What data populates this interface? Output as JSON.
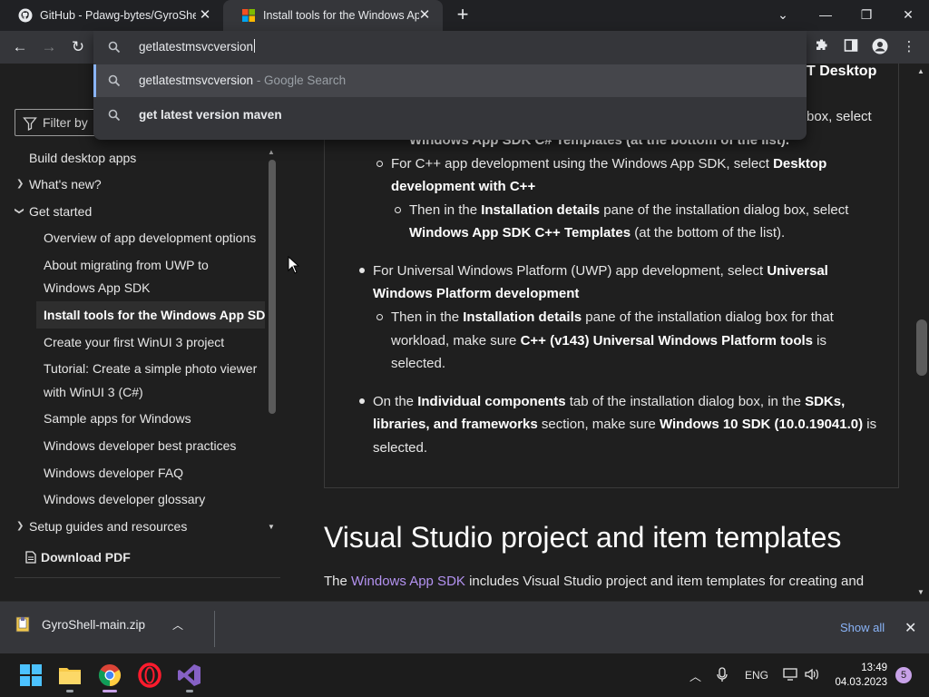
{
  "tabs": [
    {
      "title": "GitHub - Pdawg-bytes/GyroShell",
      "icon": "github-icon",
      "active": false
    },
    {
      "title": "Install tools for the Windows App",
      "icon": "microsoft-logo-icon",
      "active": true
    }
  ],
  "omnibox": {
    "value": "getlatestmsvcversion",
    "suggestions": [
      {
        "text": "getlatestmsvcversion",
        "suffix": " - Google Search",
        "highlighted": true
      },
      {
        "text": "get latest version maven",
        "suffix": "",
        "highlighted": false
      }
    ]
  },
  "page": {
    "header_fragment": "T Desktop",
    "fragment_right": "box, select",
    "fragment_cut": "Windows App SDK C# Templates (at the bottom of the list).",
    "sidebar": {
      "filter_placeholder": "Filter by",
      "items": [
        {
          "label": "Build desktop apps"
        },
        {
          "label": "What's new?"
        },
        {
          "label": "Get started"
        },
        {
          "label": "Overview of app development options"
        },
        {
          "label": "About migrating from UWP to"
        },
        {
          "label": "Windows App SDK"
        },
        {
          "label": "Install tools for the Windows App SDK"
        },
        {
          "label": "Create your first WinUI 3 project"
        },
        {
          "label": "Tutorial: Create a simple photo viewer"
        },
        {
          "label": "with WinUI 3 (C#)"
        },
        {
          "label": "Sample apps for Windows"
        },
        {
          "label": "Windows developer best practices"
        },
        {
          "label": "Windows developer FAQ"
        },
        {
          "label": "Windows developer glossary"
        },
        {
          "label": "Setup guides and resources"
        }
      ],
      "download_pdf": "Download PDF"
    },
    "content": {
      "cpp_1a": "For C++ app development using the Windows App SDK, select ",
      "cpp_1b": "Desktop",
      "cpp_2": "development with C++",
      "cpp_sub_1a": "Then in the ",
      "cpp_sub_1b": "Installation details",
      "cpp_sub_1c": " pane of the installation dialog box, select",
      "cpp_sub_2a": "Windows App SDK C++ Templates",
      "cpp_sub_2b": " (at the bottom of the list).",
      "uwp_1a": "For Universal Windows Platform (UWP) app development, select ",
      "uwp_1b": "Universal",
      "uwp_2": "Windows Platform development",
      "uwp_sub_1a": "Then in the ",
      "uwp_sub_1b": "Installation details",
      "uwp_sub_1c": " pane of the installation dialog box for that",
      "uwp_sub_2a": "workload, make sure ",
      "uwp_sub_2b": "C++ (v143) Universal Windows Platform tools",
      "uwp_sub_2c": " is",
      "uwp_sub_3": "selected.",
      "ic_1a": "On the ",
      "ic_1b": "Individual components",
      "ic_1c": " tab of the installation dialog box, in the ",
      "ic_1d": "SDKs,",
      "ic_2a": "libraries, and frameworks",
      "ic_2b": " section, make sure ",
      "ic_2c": "Windows 10 SDK (10.0.19041.0)",
      "ic_2d": " is",
      "ic_3": "selected.",
      "heading": "Visual Studio project and item templates",
      "intro_a": "The ",
      "intro_link": "Windows App SDK",
      "intro_b": " includes Visual Studio project and item templates for creating and"
    }
  },
  "downloads": {
    "file": "GyroShell-main.zip",
    "show_all": "Show all"
  },
  "taskbar": {
    "language": "ENG",
    "time": "13:49",
    "date": "04.03.2023",
    "notifications": "5"
  }
}
